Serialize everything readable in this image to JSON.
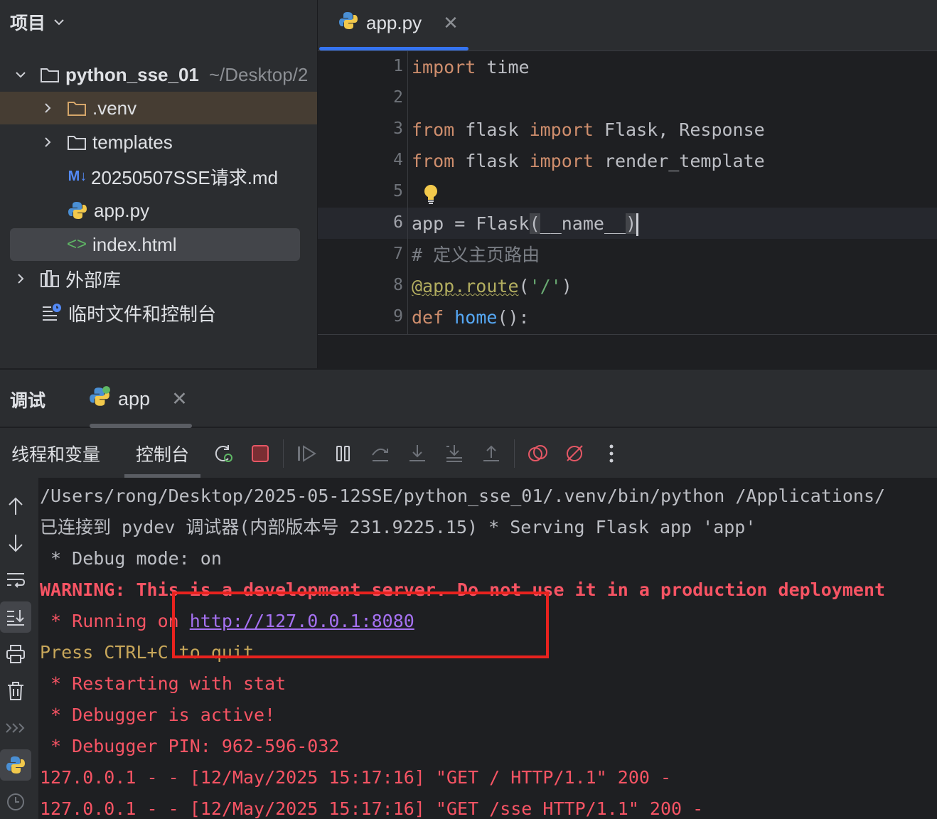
{
  "project": {
    "title": "项目",
    "root": {
      "name": "python_sse_01",
      "path": "~/Desktop/2"
    },
    "items": [
      {
        "label": ".venv",
        "icon": "folder-icon"
      },
      {
        "label": "templates",
        "icon": "folder-icon"
      },
      {
        "label": "20250507SSE请求.md",
        "icon": "markdown-icon"
      },
      {
        "label": "app.py",
        "icon": "python-icon"
      },
      {
        "label": "index.html",
        "icon": "html-icon"
      },
      {
        "label": "外部库",
        "icon": "library-icon"
      },
      {
        "label": "临时文件和控制台",
        "icon": "scratch-icon"
      }
    ]
  },
  "editor": {
    "tab": {
      "label": "app.py"
    },
    "line_numbers": [
      "1",
      "2",
      "3",
      "4",
      "5",
      "6",
      "7",
      "8",
      "9"
    ],
    "current_line": "6",
    "code": {
      "l1_kw": "import",
      "l1_rest": " time",
      "l3_kw1": "from",
      "l3_mid": " flask ",
      "l3_kw2": "import",
      "l3_rest": " Flask, Response",
      "l4_kw1": "from",
      "l4_mid": " flask ",
      "l4_kw2": "import",
      "l4_rest": " render_template",
      "l6_a": "app = Flask",
      "l6_p1": "(",
      "l6_b": "__name__",
      "l6_p2": ")",
      "l7": "# 定义主页路由",
      "l8_dec": "@app.route",
      "l8_p1": "(",
      "l8_str": "'/'",
      "l8_p2": ")",
      "l9_kw": "def",
      "l9_fn": "home",
      "l9_rest": "():"
    }
  },
  "debug": {
    "title": "调试",
    "run_tab": "app",
    "tabs": [
      "线程和变量",
      "控制台"
    ],
    "console": {
      "line1": "/Users/rong/Desktop/2025-05-12SSE/python_sse_01/.venv/bin/python /Applications/",
      "line2": "已连接到 pydev 调试器(内部版本号 231.9225.15) * Serving Flask app 'app'",
      "line3": " * Debug mode: on",
      "line4": "WARNING: This is a development server. Do not use it in a production deployment",
      "line5_prefix": " * Running on ",
      "line5_link": "http://127.0.0.1:8080",
      "line6": "Press CTRL+C to quit",
      "line7": " * Restarting with stat",
      "line8": " * Debugger is active!",
      "line9": " * Debugger PIN: 962-596-032",
      "line10": "127.0.0.1 - - [12/May/2025 15:17:16] \"GET / HTTP/1.1\" 200 -",
      "line11": "127.0.0.1 - - [12/May/2025 15:17:16] \"GET /sse HTTP/1.1\" 200 -"
    }
  },
  "colors": {
    "accent": "#3574f0",
    "keyword": "#cf8e6d",
    "function": "#56a8f5",
    "error_text": "#f75464",
    "link": "#a571f2",
    "highlight_box": "#e8221e"
  }
}
